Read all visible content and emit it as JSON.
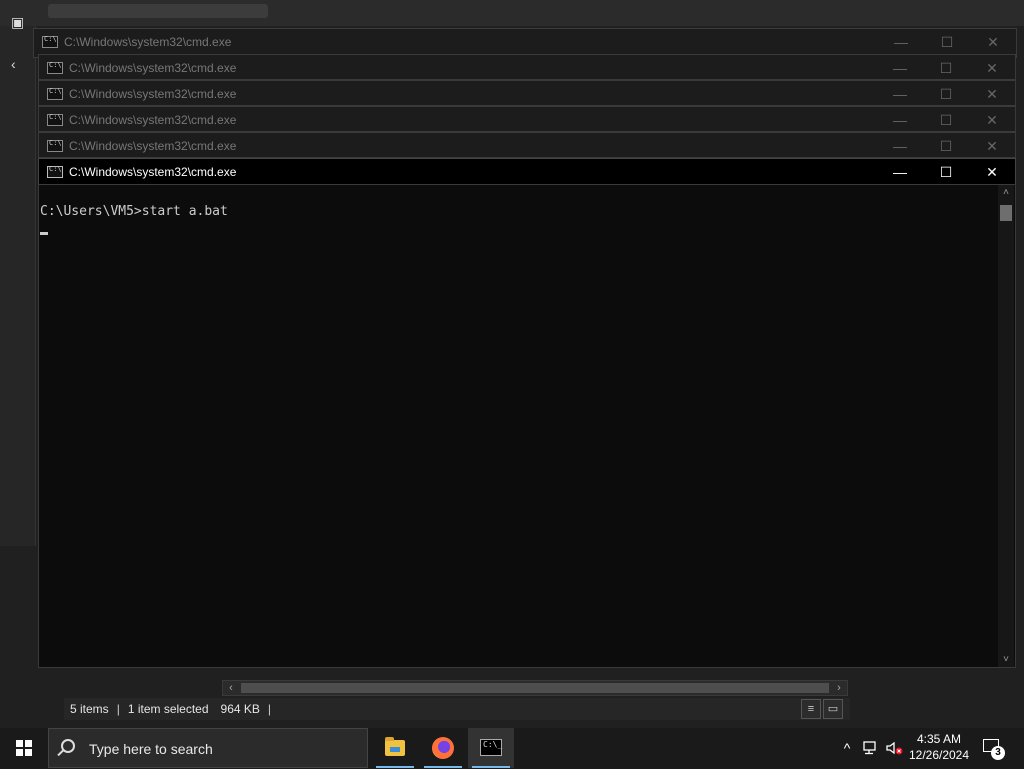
{
  "cmd_windows": [
    {
      "title": "C:\\Windows\\system32\\cmd.exe"
    },
    {
      "title": "C:\\Windows\\system32\\cmd.exe"
    },
    {
      "title": "C:\\Windows\\system32\\cmd.exe"
    },
    {
      "title": "C:\\Windows\\system32\\cmd.exe"
    },
    {
      "title": "C:\\Windows\\system32\\cmd.exe"
    },
    {
      "title": "C:\\Windows\\system32\\cmd.exe"
    }
  ],
  "window_controls": {
    "minimize": "—",
    "maximize": "☐",
    "close": "✕"
  },
  "console": {
    "line1": "C:\\Users\\VM5>start a.bat"
  },
  "explorer": {
    "status_items": "5 items",
    "status_selected": "1 item selected",
    "status_size": "964 KB",
    "separator": "|"
  },
  "taskbar": {
    "search_placeholder": "Type here to search",
    "apps": [
      "file-explorer-icon",
      "firefox-icon",
      "command-prompt-icon"
    ],
    "clock_time": "4:35 AM",
    "clock_date": "12/26/2024",
    "notification_count": "3",
    "tray_chevron": "^"
  },
  "colors": {
    "console_bg": "#0c0c0c",
    "console_fg": "#cccccc",
    "taskbar_bg": "#1a1a1a",
    "active_underline": "#76b9ed"
  }
}
